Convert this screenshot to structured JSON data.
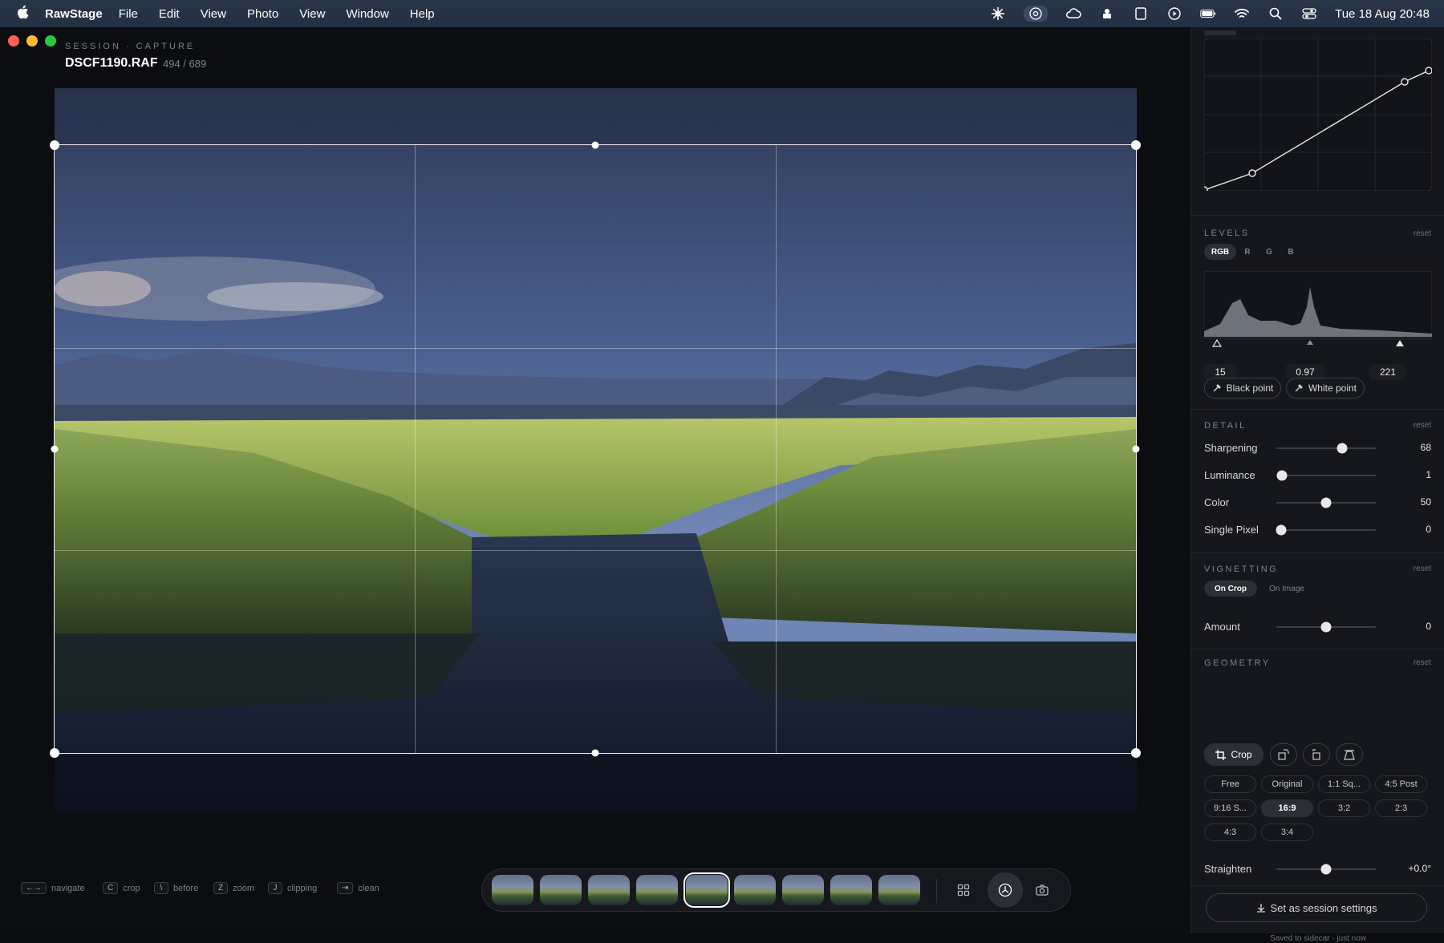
{
  "menubar": {
    "app_name": "RawStage",
    "items": [
      "File",
      "Edit",
      "View",
      "Photo",
      "View",
      "Window",
      "Help"
    ],
    "clock": "Tue 18 Aug  20:48"
  },
  "header": {
    "session_label": "SESSION · CAPTURE",
    "filename": "DSCF1190.RAF",
    "counter": "494 / 689"
  },
  "shortcuts": [
    {
      "key": "←→",
      "label": "navigate"
    },
    {
      "key": "C",
      "label": "crop"
    },
    {
      "key": "\\",
      "label": "before"
    },
    {
      "key": "Z",
      "label": "zoom"
    },
    {
      "key": "J",
      "label": "clipping"
    },
    {
      "key": "⇥",
      "label": "clean"
    }
  ],
  "filmstrip": {
    "selected_index": 4,
    "count": 9
  },
  "levels": {
    "title": "LEVELS",
    "reset": "reset",
    "channels": [
      "RGB",
      "R",
      "G",
      "B"
    ],
    "active_channel": "RGB",
    "black": "15",
    "gamma": "0.97",
    "white": "221",
    "black_point_label": "Black point",
    "white_point_label": "White point"
  },
  "detail": {
    "title": "DETAIL",
    "reset": "reset",
    "sliders": [
      {
        "label": "Sharpening",
        "value": "68",
        "fraction": 0.66
      },
      {
        "label": "Luminance",
        "value": "1",
        "fraction": 0.06
      },
      {
        "label": "Color",
        "value": "50",
        "fraction": 0.5
      },
      {
        "label": "Single Pixel",
        "value": "0",
        "fraction": 0.05
      }
    ]
  },
  "vignetting": {
    "title": "VIGNETTING",
    "reset": "reset",
    "modes": [
      "On Crop",
      "On Image"
    ],
    "active_mode": "On Crop",
    "amount_label": "Amount",
    "amount_value": "0",
    "amount_fraction": 0.5
  },
  "geometry": {
    "title": "GEOMETRY",
    "reset": "reset",
    "crop_label": "Crop",
    "ratios": [
      "Free",
      "Original",
      "1:1 Sq...",
      "4:5 Post",
      "9:16 S...",
      "16:9",
      "3:2",
      "2:3",
      "4:3",
      "3:4"
    ],
    "active_ratio": "16:9",
    "straighten_label": "Straighten",
    "straighten_value": "+0.0°",
    "straighten_fraction": 0.5
  },
  "footer": {
    "session_button": "Set as session settings",
    "saved_status": "Saved to sidecar · just now"
  }
}
